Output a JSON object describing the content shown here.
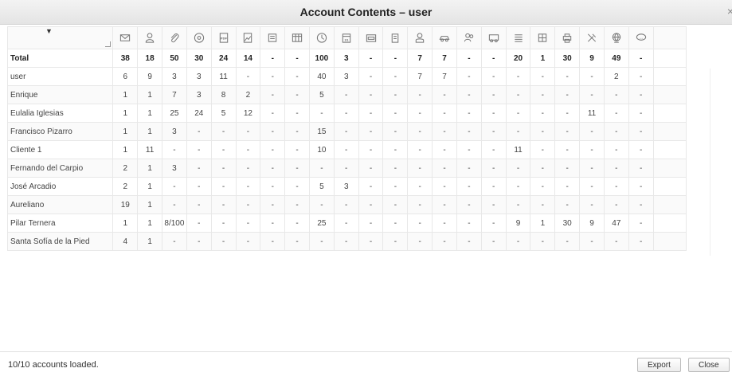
{
  "window": {
    "title": "Account Contents – user",
    "close_glyph": "×"
  },
  "table": {
    "header_icons": [
      "mail-icon",
      "contact-icon",
      "attachment-icon",
      "disk-icon",
      "pdf-doc-icon",
      "image-icon",
      "document-icon",
      "spreadsheet-icon",
      "clock-icon",
      "calendar-icon",
      "folder-icon",
      "building-icon",
      "user-icon",
      "car-icon",
      "group-icon",
      "van-icon",
      "list-icon",
      "grid-icon",
      "printer-icon",
      "tools-icon",
      "globe-icon",
      "chat-icon"
    ],
    "rows": [
      {
        "name": "Total",
        "cells": [
          "38",
          "18",
          "50",
          "30",
          "24",
          "14",
          "-",
          "-",
          "100",
          "3",
          "-",
          "-",
          "7",
          "7",
          "-",
          "-",
          "20",
          "1",
          "30",
          "9",
          "49",
          "-"
        ]
      },
      {
        "name": "user",
        "cells": [
          "6",
          "9",
          "3",
          "3",
          "11",
          "-",
          "-",
          "-",
          "40",
          "3",
          "-",
          "-",
          "7",
          "7",
          "-",
          "-",
          "-",
          "-",
          "-",
          "-",
          "2",
          "-"
        ]
      },
      {
        "name": "Enrique",
        "cells": [
          "1",
          "1",
          "7",
          "3",
          "8",
          "2",
          "-",
          "-",
          "5",
          "-",
          "-",
          "-",
          "-",
          "-",
          "-",
          "-",
          "-",
          "-",
          "-",
          "-",
          "-",
          "-"
        ]
      },
      {
        "name": "Eulalia Iglesias",
        "cells": [
          "1",
          "1",
          "25",
          "24",
          "5",
          "12",
          "-",
          "-",
          "-",
          "-",
          "-",
          "-",
          "-",
          "-",
          "-",
          "-",
          "-",
          "-",
          "-",
          "11",
          "-",
          "-"
        ]
      },
      {
        "name": "Francisco Pizarro",
        "cells": [
          "1",
          "1",
          "3",
          "-",
          "-",
          "-",
          "-",
          "-",
          "15",
          "-",
          "-",
          "-",
          "-",
          "-",
          "-",
          "-",
          "-",
          "-",
          "-",
          "-",
          "-",
          "-"
        ]
      },
      {
        "name": "Cliente 1",
        "cells": [
          "1",
          "11",
          "-",
          "-",
          "-",
          "-",
          "-",
          "-",
          "10",
          "-",
          "-",
          "-",
          "-",
          "-",
          "-",
          "-",
          "11",
          "-",
          "-",
          "-",
          "-",
          "-"
        ]
      },
      {
        "name": "Fernando del Carpio",
        "cells": [
          "2",
          "1",
          "3",
          "-",
          "-",
          "-",
          "-",
          "-",
          "-",
          "-",
          "-",
          "-",
          "-",
          "-",
          "-",
          "-",
          "-",
          "-",
          "-",
          "-",
          "-",
          "-"
        ]
      },
      {
        "name": "José Arcadio",
        "cells": [
          "2",
          "1",
          "-",
          "-",
          "-",
          "-",
          "-",
          "-",
          "5",
          "3",
          "-",
          "-",
          "-",
          "-",
          "-",
          "-",
          "-",
          "-",
          "-",
          "-",
          "-",
          "-"
        ]
      },
      {
        "name": "Aureliano",
        "cells": [
          "19",
          "1",
          "-",
          "-",
          "-",
          "-",
          "-",
          "-",
          "-",
          "-",
          "-",
          "-",
          "-",
          "-",
          "-",
          "-",
          "-",
          "-",
          "-",
          "-",
          "-",
          "-"
        ]
      },
      {
        "name": "Pilar Ternera",
        "cells": [
          "1",
          "1",
          "8/100",
          "-",
          "-",
          "-",
          "-",
          "-",
          "25",
          "-",
          "-",
          "-",
          "-",
          "-",
          "-",
          "-",
          "9",
          "1",
          "30",
          "9",
          "47",
          "-"
        ]
      },
      {
        "name": "Santa Sofía de la Pied",
        "cells": [
          "4",
          "1",
          "-",
          "-",
          "-",
          "-",
          "-",
          "-",
          "-",
          "-",
          "-",
          "-",
          "-",
          "-",
          "-",
          "-",
          "-",
          "-",
          "-",
          "-",
          "-",
          "-"
        ]
      }
    ]
  },
  "footer": {
    "status": "10/10 accounts loaded.",
    "export_label": "Export",
    "close_label": "Close"
  }
}
